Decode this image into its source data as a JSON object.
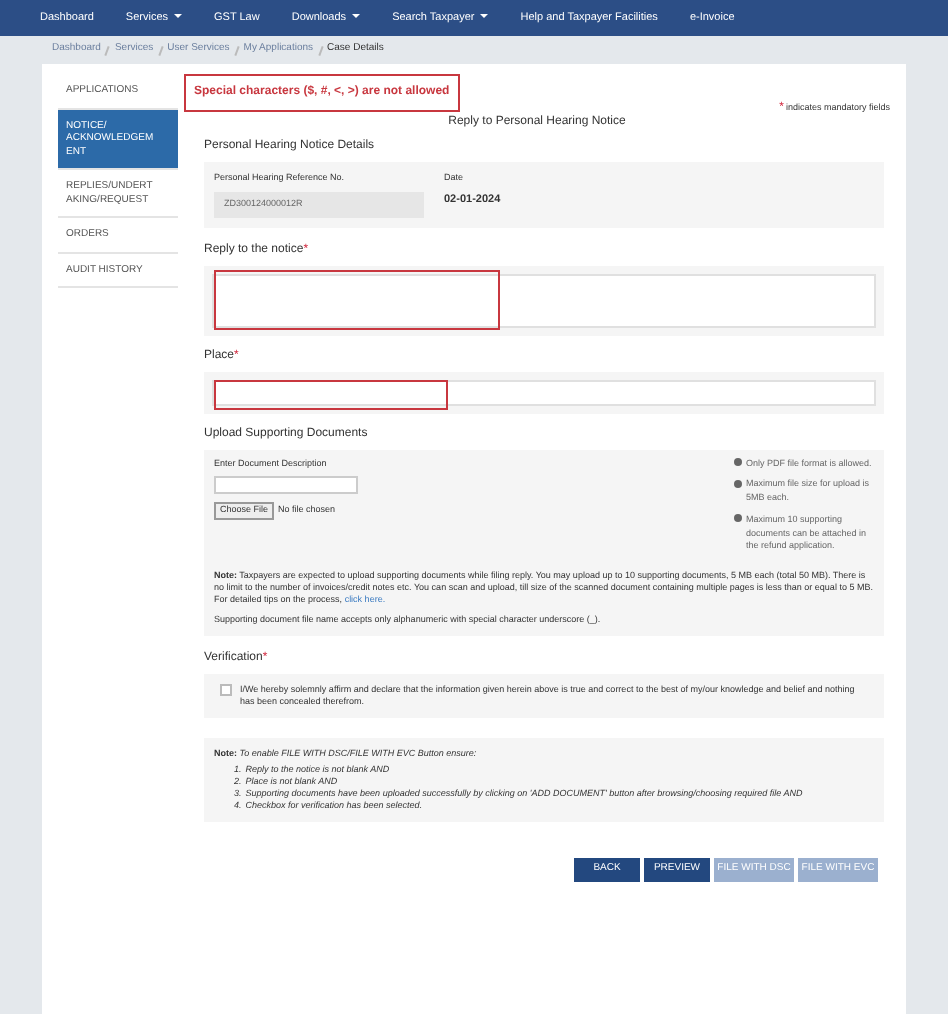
{
  "nav": [
    {
      "label": "Dashboard",
      "dropdown": false
    },
    {
      "label": "Services",
      "dropdown": true
    },
    {
      "label": "GST Law",
      "dropdown": false
    },
    {
      "label": "Downloads",
      "dropdown": true
    },
    {
      "label": "Search Taxpayer",
      "dropdown": true
    },
    {
      "label": "Help and Taxpayer Facilities",
      "dropdown": false
    },
    {
      "label": "e-Invoice",
      "dropdown": false
    }
  ],
  "breadcrumb": [
    "Dashboard",
    "Services",
    "User Services",
    "My Applications",
    "Case Details"
  ],
  "sidebar": [
    {
      "label": "APPLICATIONS",
      "selected": false
    },
    {
      "label": "NOTICE/ ACKNOWLEDGEM ENT",
      "selected": true
    },
    {
      "label": "REPLIES/UNDERT AKING/REQUEST",
      "selected": false
    },
    {
      "label": "ORDERS",
      "selected": false
    },
    {
      "label": "AUDIT HISTORY",
      "selected": false
    }
  ],
  "error": "Special characters ($, #, <, >) are not allowed",
  "mandatory_mark": "*",
  "mandatory_note": "indicates mandatory fields",
  "title": "Reply to Personal Hearing Notice",
  "details": {
    "heading": "Personal Hearing Notice Details",
    "ref_label": "Personal Hearing Reference No.",
    "ref_value": "ZD300124000012R",
    "date_label": "Date",
    "date_value": "02-01-2024"
  },
  "reply": {
    "label": "Reply to the notice",
    "mark": "*"
  },
  "place": {
    "label": "Place",
    "mark": "*"
  },
  "upload": {
    "heading": "Upload Supporting Documents",
    "desc_label": "Enter Document Description",
    "choose_file": "Choose File",
    "no_file": "No file chosen",
    "hints": [
      "Only PDF file format is allowed.",
      "Maximum file size for upload is 5MB each.",
      "Maximum 10 supporting documents can be attached in the refund application."
    ],
    "note": "**Note:** Taxpayers are expected to upload supporting documents while filing reply. You may upload up to 10 supporting documents, 5 MB each (total 50 MB). There is no limit to the number of invoices/credit notes etc. You can scan and upload, till size of the scanned document containing multiple pages is less than or equal to 5 MB. For detailed tips on the process,",
    "link": "click here.",
    "filename_note": "Supporting document file name accepts only alphanumeric with special character underscore (_)."
  },
  "verification": {
    "label": "Verification",
    "mark": "*",
    "checked": false,
    "text": "I/We hereby solemnly affirm and declare that the information given herein above is true and correct to the best of my/our knowledge and belief and nothing has been concealed therefrom."
  },
  "enable_note": {
    "intro": "**Note:** *To enable FILE WITH DSC/FILE WITH EVC Button ensure:*",
    "items": [
      {
        "number": "1.",
        "text": "Reply to the notice is not blank AND"
      },
      {
        "number": "2.",
        "text": "Place is not blank AND"
      },
      {
        "number": "3.",
        "text": "Supporting documents have been uploaded successfully by clicking on 'ADD DOCUMENT' button after browsing/choosing required file AND"
      },
      {
        "number": "4.",
        "text": "Checkbox for verification has been selected."
      }
    ]
  },
  "buttons": [
    {
      "label": "BACK",
      "disabled": false
    },
    {
      "label": "PREVIEW",
      "disabled": false
    },
    {
      "label": "FILE WITH DSC",
      "disabled": true
    },
    {
      "label": "FILE WITH EVC",
      "disabled": true
    }
  ]
}
